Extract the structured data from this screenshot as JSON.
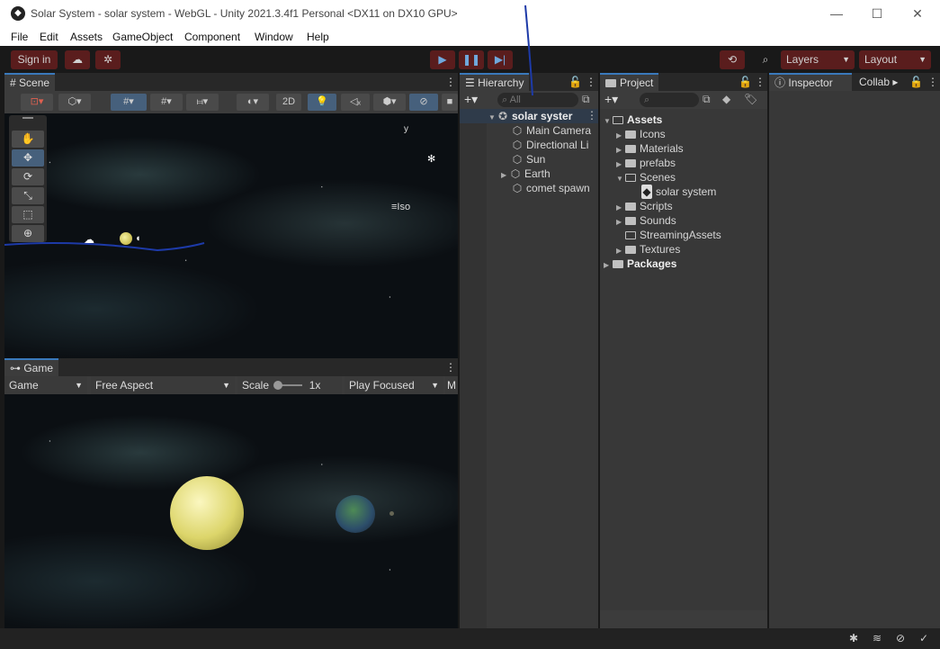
{
  "window": {
    "title": "Solar System - solar system - WebGL - Unity 2021.3.4f1 Personal <DX11 on DX10 GPU>",
    "minimize": "—",
    "maximize": "☐",
    "close": "✕"
  },
  "menu": [
    "File",
    "Edit",
    "Assets",
    "GameObject",
    "Component",
    "Window",
    "Help"
  ],
  "toolbar": {
    "sign_in": "Sign in",
    "layers": "Layers",
    "layout": "Layout"
  },
  "scene": {
    "tab": "Scene",
    "btn_2d": "2D",
    "iso_label": "Iso",
    "axis_y": "y"
  },
  "game": {
    "tab": "Game",
    "display": "Game",
    "aspect": "Free Aspect",
    "scale_label": "Scale",
    "scale_value": "1x",
    "play_mode": "Play Focused",
    "more": "M"
  },
  "hierarchy": {
    "tab": "Hierarchy",
    "search_placeholder": "All",
    "root": "solar syster",
    "items": [
      "Main Camera",
      "Directional Li",
      "Sun",
      "Earth",
      "comet spawn"
    ]
  },
  "project": {
    "tab": "Project",
    "assets": "Assets",
    "folders": [
      "Icons",
      "Materials",
      "prefabs",
      "Scenes",
      "Scripts",
      "Sounds",
      "StreamingAssets",
      "Textures"
    ],
    "scene_file": "solar system",
    "packages": "Packages"
  },
  "inspector": {
    "tab": "Inspector",
    "collab_tab": "Collab"
  }
}
